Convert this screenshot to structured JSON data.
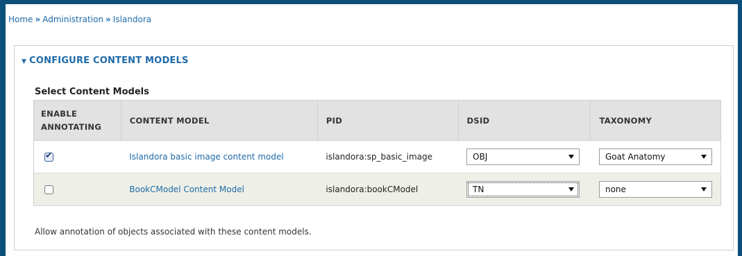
{
  "breadcrumb": {
    "items": [
      "Home",
      "Administration",
      "Islandora"
    ],
    "separator": "»"
  },
  "fieldset": {
    "legend": "CONFIGURE CONTENT MODELS",
    "subtitle": "Select Content Models",
    "description": "Allow annotation of objects associated with these content models."
  },
  "table": {
    "headers": {
      "enable_line1": "ENABLE",
      "enable_line2": "ANNOTATING",
      "content_model": "CONTENT MODEL",
      "pid": "PID",
      "dsid": "DSID",
      "taxonomy": "TAXONOMY"
    },
    "rows": [
      {
        "checked": true,
        "content_model": "Islandora basic image content model",
        "pid": "islandora:sp_basic_image",
        "dsid": "OBJ",
        "taxonomy": "Goat Anatomy"
      },
      {
        "checked": false,
        "content_model": "BookCModel Content Model",
        "pid": "islandora:bookCModel",
        "dsid": "TN",
        "taxonomy": "none"
      }
    ]
  },
  "colors": {
    "link": "#1f6aa8",
    "header_bg": "#e2e2e2",
    "alt_row_bg": "#eef0e8",
    "frame": "#0b4f7a"
  }
}
